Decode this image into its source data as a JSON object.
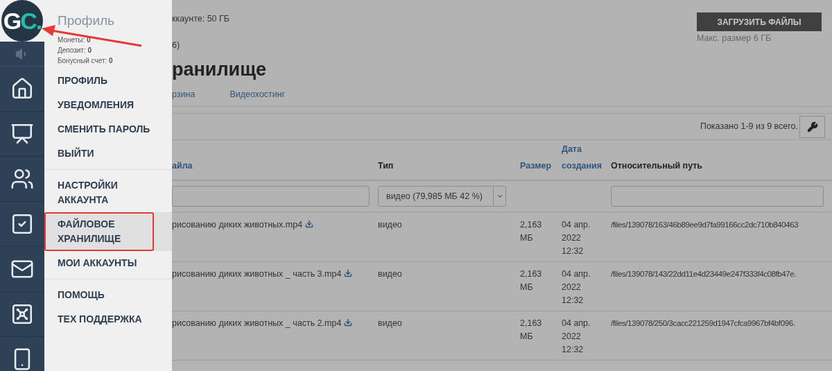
{
  "logo": [
    {
      "text": "G",
      "color": "#ffffff"
    },
    {
      "text": "C.",
      "color": "#20c0a8"
    }
  ],
  "profile_menu": {
    "title": "Профиль",
    "balances": [
      "Монеты: **0**",
      "Депозит: **0**",
      "Бонусный счет: **0**"
    ],
    "groups": [
      [
        {
          "label": "ПРОФИЛЬ",
          "selected": false
        },
        {
          "label": "УВЕДОМЛЕНИЯ",
          "selected": false
        },
        {
          "label": "СМЕНИТЬ ПАРОЛЬ",
          "selected": false
        },
        {
          "label": "ВЫЙТИ",
          "selected": false
        }
      ],
      [
        {
          "label": "НАСТРОЙКИ АККАУНТА",
          "selected": false
        },
        {
          "label": "ФАЙЛОВОЕ ХРАНИЛИЩЕ",
          "selected": true
        },
        {
          "label": "МОИ АККАУНТЫ",
          "selected": false
        }
      ],
      [
        {
          "label": "ПОМОЩЬ",
          "selected": false
        },
        {
          "label": "ТЕХ ПОДДЕРЖКА",
          "selected": false
        }
      ]
    ]
  },
  "account": {
    "storage": "ккаунте: 50 ГБ",
    "count": "6)"
  },
  "upload": {
    "button": "ЗАГРУЗИТЬ ФАЙЛЫ",
    "note": "Макс. размер 6 ГБ"
  },
  "heading": "ранилище",
  "tabs": [
    {
      "label": "рзина",
      "selected": false
    },
    {
      "label": "Видеохостинг",
      "selected": false
    }
  ],
  "table": {
    "summary": "Показано 1-9 из 9 всего.",
    "columns": [
      {
        "label": "айла",
        "kind": "link"
      },
      {
        "label": "Тип",
        "kind": "plain"
      },
      {
        "label": "Размер",
        "kind": "link"
      },
      {
        "label": "Дата создания",
        "kind": "link"
      },
      {
        "label": "Относительный путь",
        "kind": "plain"
      }
    ],
    "filters": [
      {
        "kind": "input"
      },
      {
        "kind": "select",
        "value": "видео (79,985 МБ 42 %)"
      },
      {
        "kind": "none"
      },
      {
        "kind": "none"
      },
      {
        "kind": "input"
      }
    ],
    "rows": [
      {
        "name": "рисованию диких животных.mp4",
        "type": "видео",
        "size": "2,163 МБ",
        "date": "04 апр. 2022 12:32",
        "path": "/files/139078/163/46b89ee9d7fa99166cc2dc710b840463"
      },
      {
        "name": "рисованию диких животных _ часть 3.mp4",
        "type": "видео",
        "size": "2,163 МБ",
        "date": "04 апр. 2022 12:32",
        "path": "/files/139078/143/22dd11e4d23449e247f333f4c08fb47e."
      },
      {
        "name": "рисованию диких животных _ часть 2.mp4",
        "type": "видео",
        "size": "2,163 МБ",
        "date": "04 апр. 2022 12:32",
        "path": "/files/139078/250/3cacc221259d1947cfca9967bf4bf096."
      }
    ]
  }
}
